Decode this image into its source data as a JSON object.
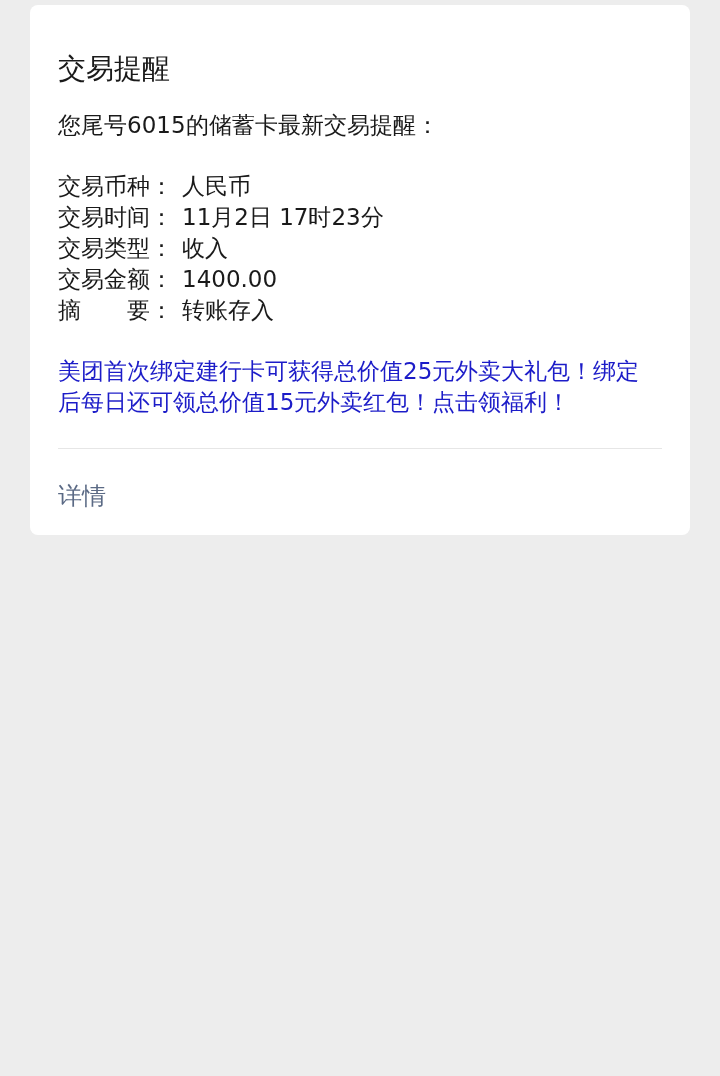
{
  "card": {
    "title": "交易提醒",
    "intro": "您尾号6015的储蓄卡最新交易提醒：",
    "fields": [
      {
        "label": "交易币种：",
        "value": "人民币"
      },
      {
        "label": "交易时间：",
        "value": "11月2日 17时23分"
      },
      {
        "label": "交易类型：",
        "value": "收入"
      },
      {
        "label": "交易金额：",
        "value": "1400.00"
      },
      {
        "label": "摘　　要：",
        "value": "转账存入"
      }
    ],
    "promo": "美团首次绑定建行卡可获得总价值25元外卖大礼包！绑定后每日还可领总价值15元外卖红包！点击领福利！",
    "details_link": "详情"
  }
}
